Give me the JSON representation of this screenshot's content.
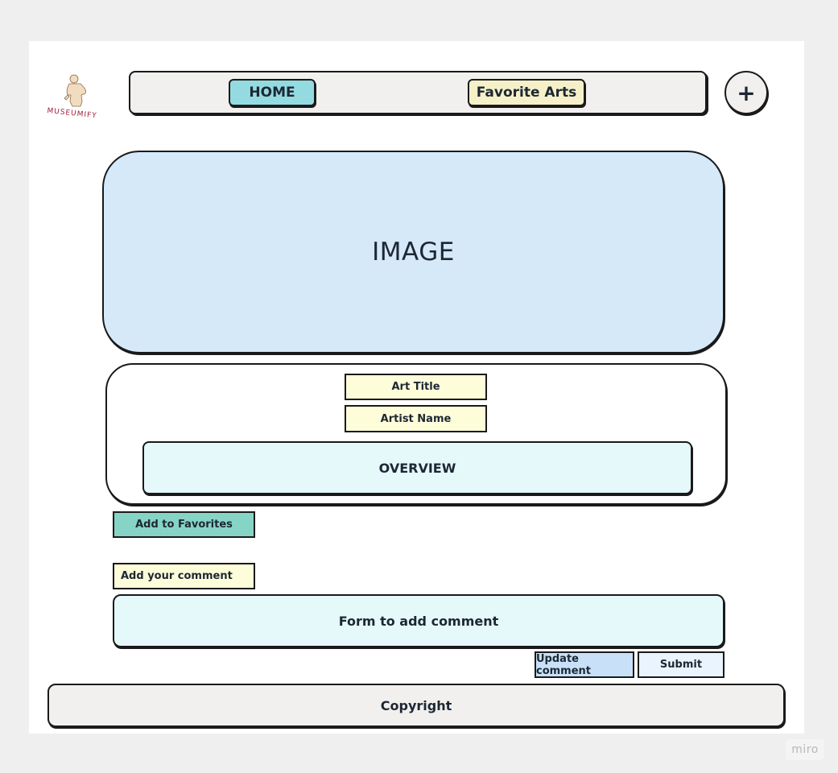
{
  "brand": {
    "logo_text": "MUSEUMIFY"
  },
  "nav": {
    "home_label": "HOME",
    "favorites_label": "Favorite Arts",
    "add_label": "+"
  },
  "artwork": {
    "image_placeholder": "IMAGE",
    "title_label": "Art Title",
    "artist_label": "Artist Name",
    "overview_label": "OVERVIEW"
  },
  "actions": {
    "add_to_favorites_label": "Add to Favorites"
  },
  "comments": {
    "add_comment_label": "Add your comment",
    "form_label": "Form to add comment",
    "update_label": "Update comment",
    "submit_label": "Submit"
  },
  "footer": {
    "copyright_label": "Copyright"
  },
  "watermark": {
    "text": "miro"
  },
  "colors": {
    "nav_background": "#f1f0ee",
    "home_button": "#94dbe1",
    "favorites_button": "#f6f0c8",
    "image_background": "#d5e9f9",
    "label_yellow": "#fefdd9",
    "panel_cyan": "#e5f8fa",
    "add_favorites_green": "#86d4c5",
    "update_blue": "#c8e1f8",
    "submit_blue": "#eaf4ff",
    "outline": "#1a1a1a"
  }
}
